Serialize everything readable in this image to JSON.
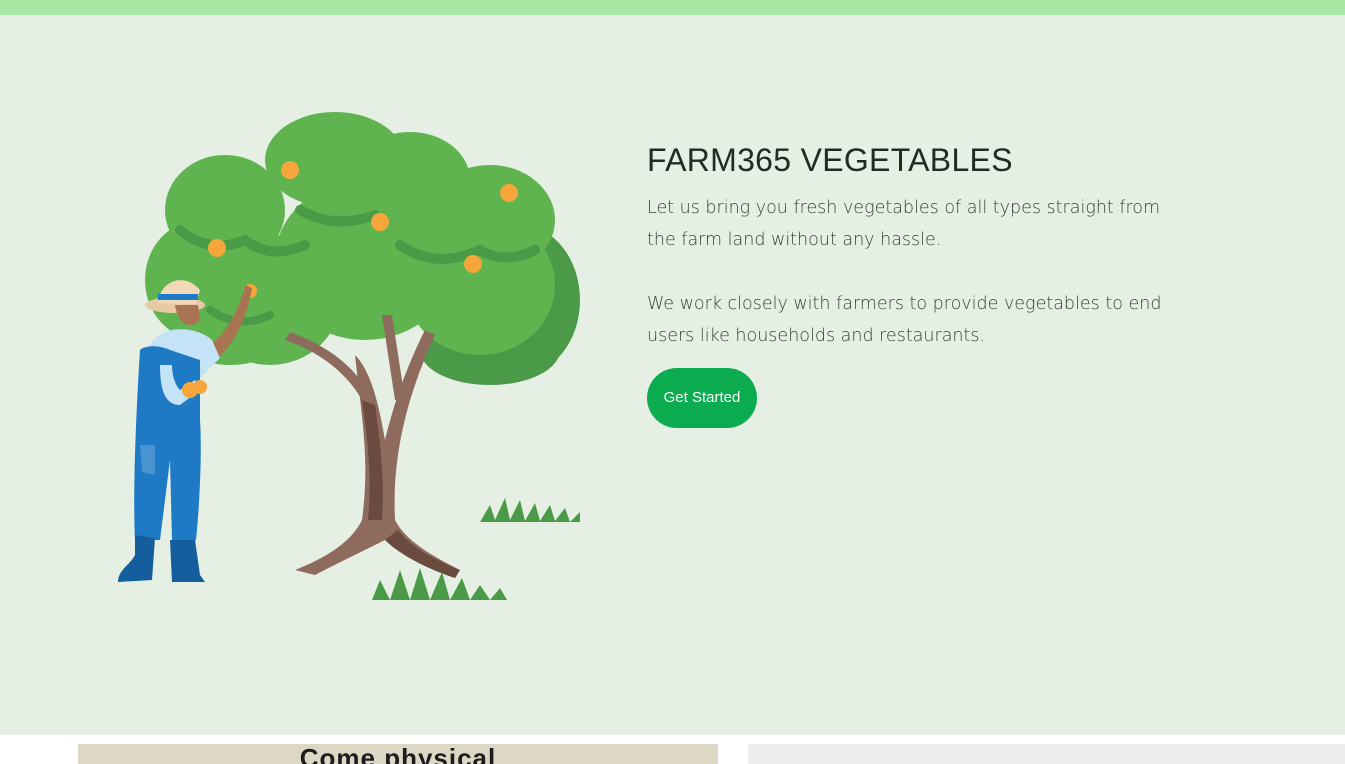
{
  "hero": {
    "title": "FARM365 VEGETABLES",
    "paragraph_1": "Let us bring you fresh vegetables of all types straight from the farm land without any hassle.",
    "paragraph_2": "We work closely with farmers to provide vegetables to end users like households and restaurants.",
    "cta_label": "Get Started",
    "illustration": "farmer-picking-oranges-illustration"
  },
  "cards": {
    "left_title": "Come physical"
  },
  "colors": {
    "top_strip": "#a7e9a4",
    "hero_background": "#e5efe4",
    "cta_background": "#0aac4f",
    "tree_leaves": "#5fb450",
    "tree_leaves_dark": "#4a9a47",
    "trunk": "#8f6b5e",
    "orange": "#f6a63a",
    "overalls": "#1f7ac6"
  }
}
